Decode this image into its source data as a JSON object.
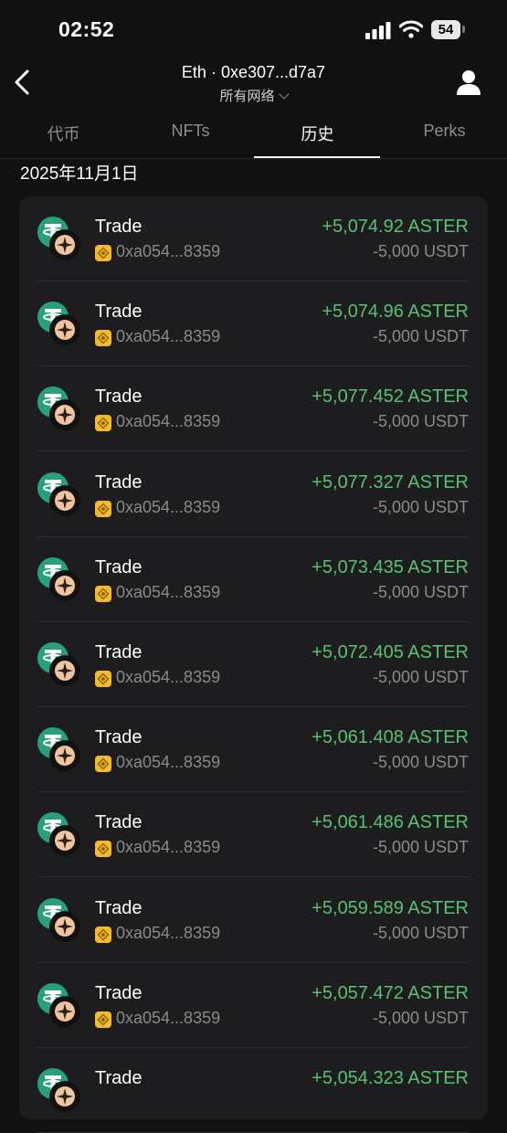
{
  "status": {
    "time": "02:52",
    "battery": "54"
  },
  "header": {
    "token": "Eth",
    "separator": "·",
    "address": "0xe307...d7a7",
    "network": "所有网络"
  },
  "tabs": [
    {
      "label": "代币",
      "active": false
    },
    {
      "label": "NFTs",
      "active": false
    },
    {
      "label": "历史",
      "active": true
    },
    {
      "label": "Perks",
      "active": false
    }
  ],
  "date_heading": "2025年11月1日",
  "transactions": [
    {
      "type": "Trade",
      "address": "0xa054...8359",
      "received": "+5,074.92 ASTER",
      "sent": "-5,000 USDT"
    },
    {
      "type": "Trade",
      "address": "0xa054...8359",
      "received": "+5,074.96 ASTER",
      "sent": "-5,000 USDT"
    },
    {
      "type": "Trade",
      "address": "0xa054...8359",
      "received": "+5,077.452 ASTER",
      "sent": "-5,000 USDT"
    },
    {
      "type": "Trade",
      "address": "0xa054...8359",
      "received": "+5,077.327 ASTER",
      "sent": "-5,000 USDT"
    },
    {
      "type": "Trade",
      "address": "0xa054...8359",
      "received": "+5,073.435 ASTER",
      "sent": "-5,000 USDT"
    },
    {
      "type": "Trade",
      "address": "0xa054...8359",
      "received": "+5,072.405 ASTER",
      "sent": "-5,000 USDT"
    },
    {
      "type": "Trade",
      "address": "0xa054...8359",
      "received": "+5,061.408 ASTER",
      "sent": "-5,000 USDT"
    },
    {
      "type": "Trade",
      "address": "0xa054...8359",
      "received": "+5,061.486 ASTER",
      "sent": "-5,000 USDT"
    },
    {
      "type": "Trade",
      "address": "0xa054...8359",
      "received": "+5,059.589 ASTER",
      "sent": "-5,000 USDT"
    },
    {
      "type": "Trade",
      "address": "0xa054...8359",
      "received": "+5,057.472 ASTER",
      "sent": "-5,000 USDT"
    },
    {
      "type": "Trade",
      "address": "",
      "received": "+5,054.323 ASTER",
      "sent": ""
    }
  ],
  "colors": {
    "background": "#111111",
    "card": "#1d1d1f",
    "positive": "#58c173",
    "muted": "#8a8a8a",
    "usdt": "#26a17b",
    "bnb": "#f3ba2f",
    "aster": "#f0c59d"
  },
  "icons": {
    "back": "chevron-left-icon",
    "profile": "user-icon",
    "token_in": "usdt-icon",
    "token_out": "aster-icon",
    "chain": "bnb-chain-icon"
  }
}
